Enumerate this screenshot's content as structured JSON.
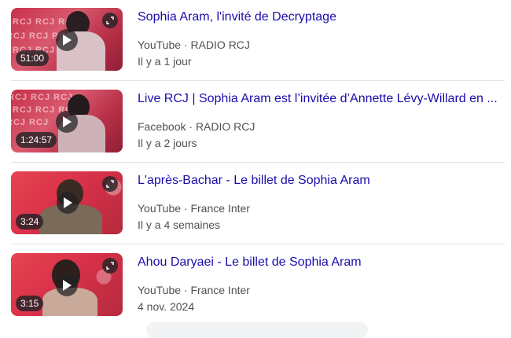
{
  "colors": {
    "link": "#1a0dab",
    "meta": "#4d5156",
    "divider": "#e3e3e3"
  },
  "icons": {
    "play": "play-icon",
    "expand": "expand-icon"
  },
  "videos": [
    {
      "title": "Sophia Aram, l'invité de Decryptage",
      "platform": "YouTube",
      "channel": "RADIO RCJ",
      "date": "Il y a 1 jour",
      "duration": "51:00"
    },
    {
      "title": "Live RCJ | Sophia Aram est l’invitée d’Annette Lévy-Willard en ...",
      "platform": "Facebook",
      "channel": "RADIO RCJ",
      "date": "Il y a 2 jours",
      "duration": "1:24:57"
    },
    {
      "title": "L'après-Bachar - Le billet de Sophia Aram",
      "platform": "YouTube",
      "channel": "France Inter",
      "date": "Il y a 4 semaines",
      "duration": "3:24"
    },
    {
      "title": "Ahou Daryaei - Le billet de Sophia Aram",
      "platform": "YouTube",
      "channel": "France Inter",
      "date": "4 nov. 2024",
      "duration": "3:15"
    }
  ],
  "separator": " · "
}
